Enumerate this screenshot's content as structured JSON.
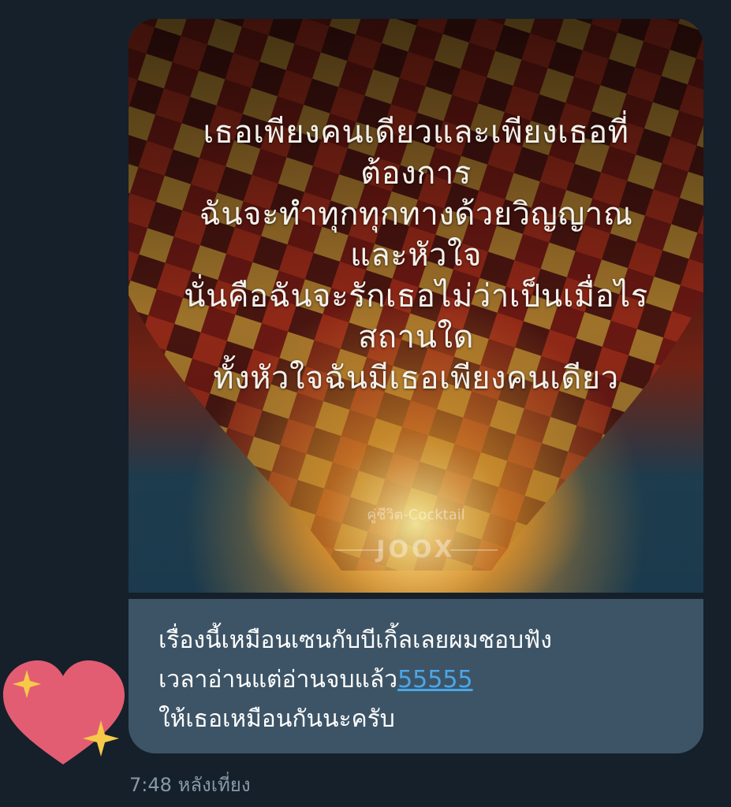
{
  "media": {
    "lyrics": [
      "เธอเพียงคนเดียวและเพียงเธอที่",
      "ต้องการ",
      "ฉันจะทำทุกทุกทางด้วยวิญญาณ",
      "และหัวใจ",
      "นั่นคือฉันจะรักเธอไม่ว่าเป็นเมื่อไร",
      "สถานใด",
      "ทั้งหัวใจฉันมีเธอเพียงคนเดียว"
    ],
    "song_watermark": "คู่ชีวิต-Cocktail",
    "app_watermark": "JOOX"
  },
  "message": {
    "line1": "เรื่องนี้เหมือนเซนกับบีเกิ้ลเลยผมชอบฟัง",
    "line2_text": "เวลาอ่านแต่อ่านจบแล้ว",
    "line2_link": "55555",
    "line3": "ให้เธอเหมือนกันนะครับ"
  },
  "timestamp": "7:48 หลังเที่ยง",
  "reaction": {
    "icon": "sparkling-heart-icon"
  },
  "colors": {
    "background": "#15202b",
    "bubble": "#3d5466",
    "link": "#4aa7ea",
    "timestamp": "#8899a6",
    "heart": "#e35d72",
    "sparkle": "#f7c948"
  }
}
